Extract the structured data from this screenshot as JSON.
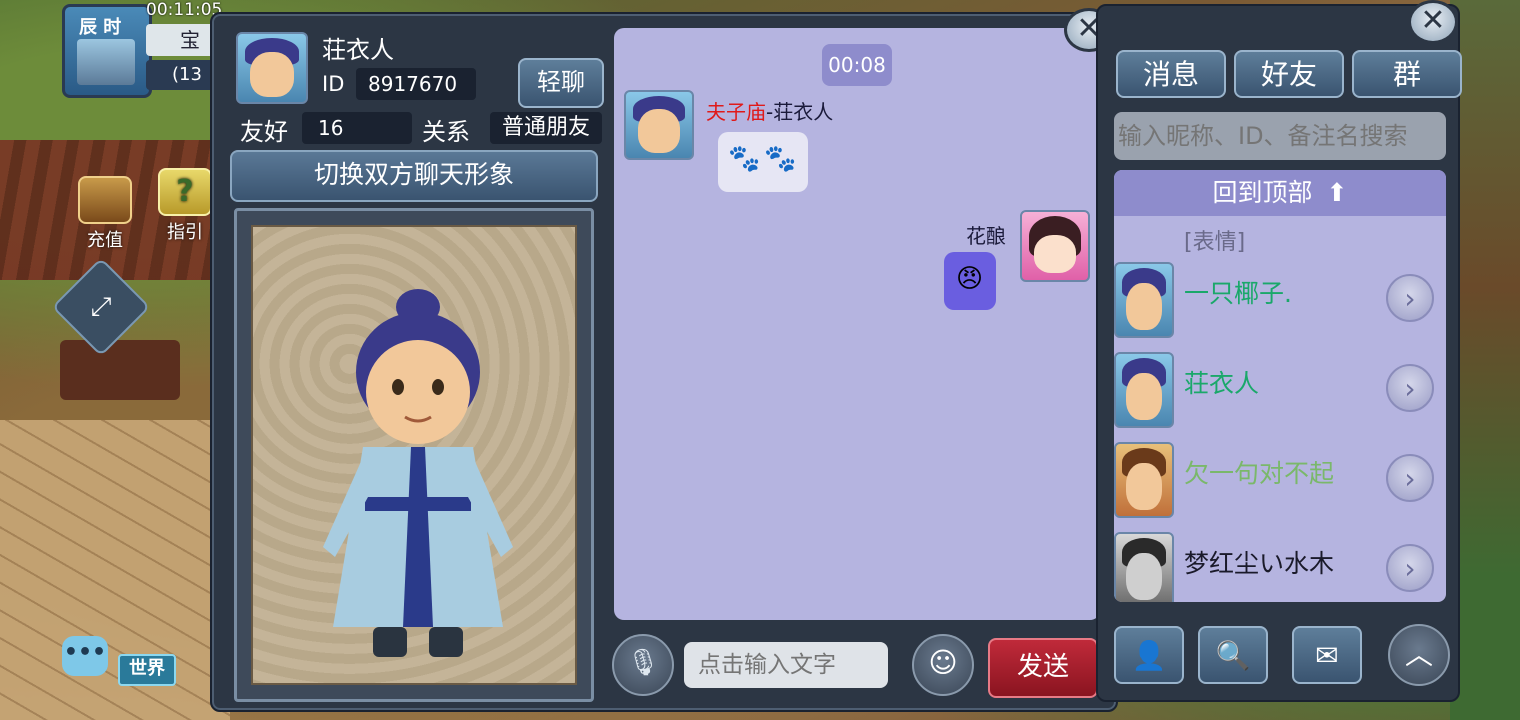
{
  "hud": {
    "period": "辰 时",
    "clock": "00:11:05",
    "box1": "宝",
    "box2": "(13",
    "recharge": "充值",
    "guide": "指引",
    "world": "世界"
  },
  "chat_window": {
    "friend_name": "荘衣人",
    "id_label": "ID",
    "id_value": "8917670",
    "qingliao": "轻聊",
    "favor_label": "友好",
    "favor_value": "16",
    "relation_label": "关系",
    "relation_value": "普通朋友",
    "switch_button": "切换双方聊天形象",
    "timestamp": "00:08",
    "messages": [
      {
        "side": "left",
        "guild": "夫子庙",
        "separator": "-",
        "sender": "荘衣人"
      },
      {
        "side": "right",
        "sender": "花酿"
      }
    ],
    "input_placeholder": "点击输入文字",
    "send": "发送"
  },
  "friends_panel": {
    "tabs": [
      "消息",
      "好友",
      "群"
    ],
    "search_placeholder": "输入昵称、ID、备注名搜索",
    "back_to_top": "回到顶部",
    "partial_item_text": "[表情]",
    "friends": [
      {
        "name": "一只椰子.",
        "color": "#1aa86a"
      },
      {
        "name": "荘衣人",
        "color": "#1aa86a"
      },
      {
        "name": "欠一句对不起",
        "color": "#7ab86a"
      },
      {
        "name": "梦红尘い水木",
        "color": "#1a1a2a"
      }
    ]
  },
  "colors": {
    "panel_bg": "#2c3644",
    "chat_bg": "#b5b4e0",
    "send_red": "#c02a3a",
    "guild_red": "#e01a1a"
  }
}
